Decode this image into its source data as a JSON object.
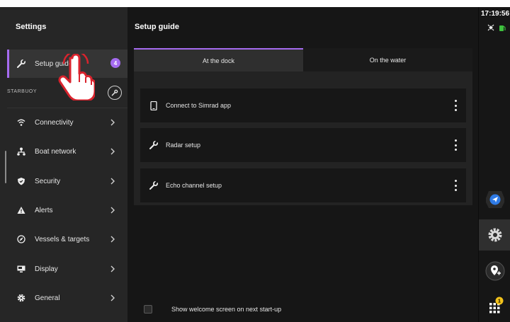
{
  "left_panel": {
    "title": "Settings",
    "setup_guide": {
      "label": "Setup guide",
      "badge": "4",
      "icon": "wrench-icon"
    },
    "section_label": "STARBUOY",
    "items": [
      {
        "label": "Connectivity",
        "icon": "wifi-icon"
      },
      {
        "label": "Boat network",
        "icon": "network-icon"
      },
      {
        "label": "Security",
        "icon": "shield-icon"
      },
      {
        "label": "Alerts",
        "icon": "alert-icon"
      },
      {
        "label": "Vessels & targets",
        "icon": "target-icon"
      },
      {
        "label": "Display",
        "icon": "display-icon"
      },
      {
        "label": "General",
        "icon": "gear-icon"
      }
    ]
  },
  "main": {
    "title": "Setup guide",
    "tabs": [
      {
        "label": "At the dock",
        "selected": true
      },
      {
        "label": "On the water",
        "selected": false
      }
    ],
    "cards": [
      {
        "label": "Connect to Simrad app",
        "icon": "phone-icon"
      },
      {
        "label": "Radar setup",
        "icon": "wrench-icon"
      },
      {
        "label": "Echo channel setup",
        "icon": "wrench-icon"
      }
    ],
    "footer": {
      "checkbox_label": "Show welcome screen on next start-up",
      "checked": false
    }
  },
  "rail": {
    "time": "17:19:56",
    "icons": [
      "satellite-icon",
      "fuel-icon",
      "navigate-icon",
      "settings-icon",
      "add-waypoint-icon",
      "apps-grid-icon"
    ],
    "apps_badge": "1"
  },
  "colors": {
    "accent": "#a56bf0",
    "navigate_blue": "#2f7be6",
    "badge_yellow": "#f2c21b",
    "fuel_green": "#3ec13e"
  }
}
